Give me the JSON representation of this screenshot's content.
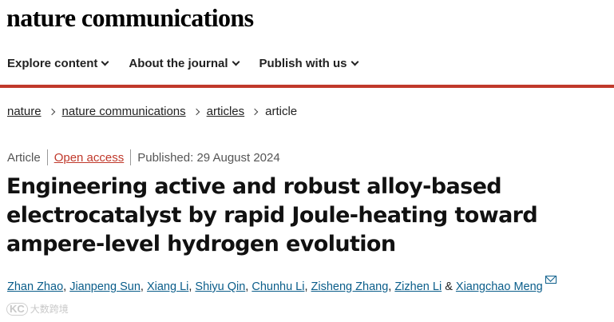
{
  "header": {
    "brand": "nature communications",
    "nav": [
      {
        "label": "Explore content"
      },
      {
        "label": "About the journal"
      },
      {
        "label": "Publish with us"
      }
    ],
    "accent_color": "#c0392b"
  },
  "breadcrumb": {
    "items": [
      "nature",
      "nature communications",
      "articles"
    ],
    "current": "article"
  },
  "article": {
    "type": "Article",
    "access": "Open access",
    "published": "Published: 29 August 2024",
    "title": "Engineering active and robust alloy-based electrocatalyst by rapid Joule-heating toward ampere-level hydrogen evolution",
    "authors": [
      "Zhan Zhao",
      "Jianpeng Sun",
      "Xiang Li",
      "Shiyu Qin",
      "Chunhu Li",
      "Zisheng Zhang",
      "Zizhen Li",
      "Xiangchao Meng"
    ],
    "author_conjunction": "&",
    "link_color": "#0a5d8a"
  },
  "watermark": {
    "logo": "KC",
    "text": "大数跨境"
  }
}
